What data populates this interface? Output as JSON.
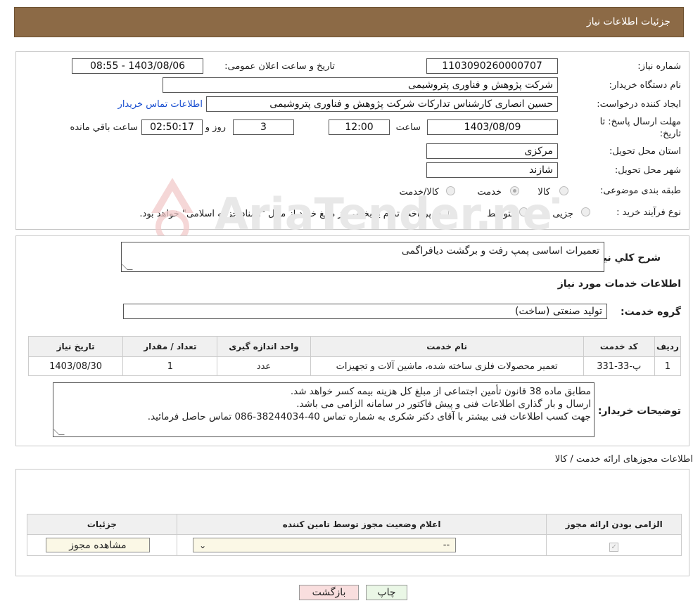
{
  "header": {
    "title": "جزئیات اطلاعات نیاز"
  },
  "fields": {
    "need_number_label": "شماره نیاز:",
    "need_number": "1103090260000707",
    "announce_label": "تاریخ و ساعت اعلان عمومی:",
    "announce_value": "1403/08/06 - 08:55",
    "buyer_org_label": "نام دستگاه خریدار:",
    "buyer_org": "شرکت پژوهش و فناوری پتروشیمی",
    "creator_label": "ایجاد کننده درخواست:",
    "creator": "حسین انصاری کارشناس تداركات شرکت پژوهش و فناوری پتروشیمی",
    "contact_link": "اطلاعات تماس خریدار",
    "deadline_label_1": "مهلت ارسال پاسخ: تا",
    "deadline_label_2": "تاریخ:",
    "deadline_date": "1403/08/09",
    "time_label": "ساعت",
    "deadline_time": "12:00",
    "days_value": "3",
    "days_label": "روز و",
    "remaining_value": "02:50:17",
    "remaining_label": "ساعت باقي مانده",
    "province_label": "استان محل تحویل:",
    "province": "مرکزی",
    "city_label": "شهر محل تحویل:",
    "city": "شازند",
    "category_label": "طبقه بندی موضوعی:",
    "category_options": [
      "کالا",
      "خدمت",
      "کالا/خدمت"
    ],
    "purchase_type_label": "نوع فرآیند خرید :",
    "purchase_options": [
      "جزیی",
      "متوسط"
    ],
    "payment_note": "پرداخت تمام یا بخشی از مبلغ خرید،از محل \"اسناد خزانه اسلامی\" خواهد بود."
  },
  "summary": {
    "label": "شرح کلي نیاز:",
    "value": "تعمیرات اساسی پمپ رفت و برگشت دیافراگمی"
  },
  "services": {
    "title": "اطلاعات خدمات مورد نیاز",
    "group_label": "گروه خدمت:",
    "group_value": "تولید صنعتی (ساخت)",
    "columns": [
      "ردیف",
      "کد خدمت",
      "نام خدمت",
      "واحد اندازه گیری",
      "تعداد / مقدار",
      "تاریخ نیاز"
    ],
    "rows": [
      [
        "1",
        "پ-33-331",
        "تعمیر محصولات فلزی ساخته شده، ماشین آلات و تجهیزات",
        "عدد",
        "1",
        "1403/08/30"
      ]
    ]
  },
  "buyer_notes": {
    "label": "توضیحات خریدار:",
    "line1": "مطابق ماده 38 قانون تأمین اجتماعی از مبلغ کل هزینه بیمه کسر خواهد شد.",
    "line2": "ارسال و بار گذاری اطلاعات فنی و پیش فاکتور در سامانه الزامی می باشد.",
    "line3": "جهت کسب اطلاعات فنی بیشتر با آقای دکتر شکری به شماره تماس  40-38244034-086 تماس حاصل فرمائید."
  },
  "permits": {
    "title": "اطلاعات مجوزهای ارائه خدمت / کالا",
    "columns": [
      "الزامی بودن ارائه مجوز",
      "اعلام وضعیت مجوز توسط تامین کننده",
      "جزئیات"
    ],
    "select_value": "--",
    "view_button": "مشاهده مجوز"
  },
  "actions": {
    "print": "چاپ",
    "back": "بازگشت"
  },
  "watermark": {
    "text": "AriaTender.neT"
  },
  "colors": {
    "header_bg": "#8c6a46",
    "link": "#1a4fd0",
    "back_btn_bg": "#f9dede",
    "print_btn_bg": "#eaf7e6"
  }
}
